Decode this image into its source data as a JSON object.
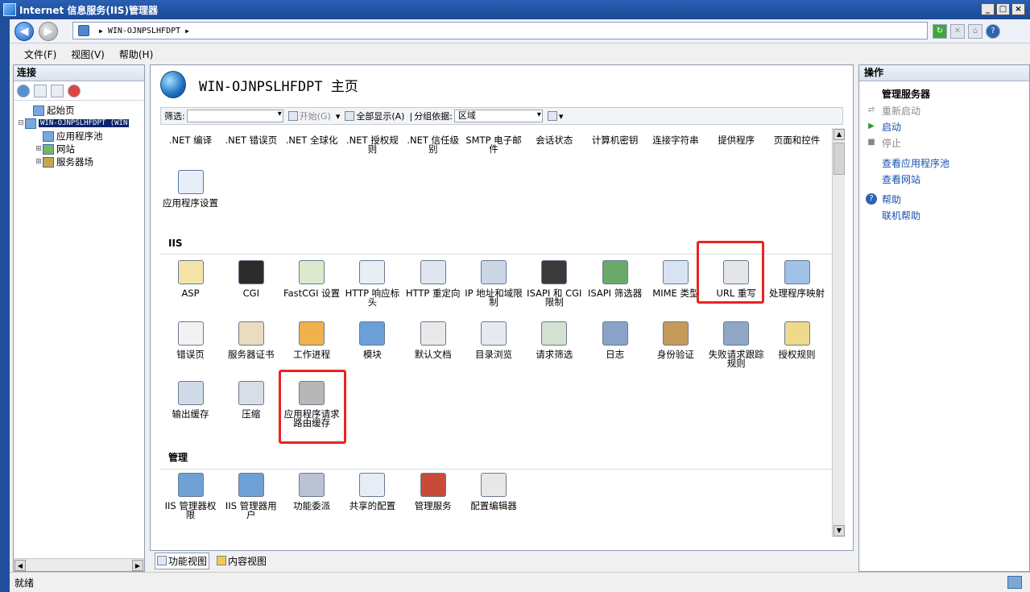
{
  "window": {
    "title": "Internet 信息服务(IIS)管理器",
    "controls": [
      "_",
      "□",
      "×"
    ]
  },
  "address": {
    "path": "WIN-OJNPSLHFDPT",
    "toolbar_icons": [
      "refresh-icon",
      "stop-icon",
      "home-icon",
      "help-icon"
    ]
  },
  "menu": [
    "文件(F)",
    "视图(V)",
    "帮助(H)"
  ],
  "connections": {
    "title": "连接",
    "tree": [
      {
        "label": "起始页",
        "indent": 1,
        "glyph": ""
      },
      {
        "label": "WIN-OJNPSLHFDPT (WIN",
        "indent": 0,
        "glyph": "⊟",
        "selected": true
      },
      {
        "label": "应用程序池",
        "indent": 2,
        "glyph": ""
      },
      {
        "label": "网站",
        "indent": 1,
        "glyph": "⊞"
      },
      {
        "label": "服务器场",
        "indent": 1,
        "glyph": "⊞"
      }
    ]
  },
  "main": {
    "title": "WIN-OJNPSLHFDPT 主页",
    "filter": {
      "label": "筛选:",
      "go": "开始(G)",
      "show_all": "全部显示(A)",
      "group_label": "分组依据:",
      "group_value": "区域"
    },
    "aspnet_row": [
      ".NET 编译",
      ".NET 错误页",
      ".NET 全球化",
      ".NET 授权规则",
      ".NET 信任级别",
      "SMTP 电子邮件",
      "会话状态",
      "计算机密钥",
      "连接字符串",
      "提供程序",
      "页面和控件"
    ],
    "aspnet_row2": [
      "应用程序设置"
    ],
    "sections": {
      "iis": "IIS",
      "manage": "管理"
    },
    "iis_row1": [
      "ASP",
      "CGI",
      "FastCGI 设置",
      "HTTP 响应标头",
      "HTTP 重定向",
      "IP 地址和域限制",
      "ISAPI 和 CGI 限制",
      "ISAPI 筛选器",
      "MIME 类型",
      "URL 重写",
      "处理程序映射"
    ],
    "iis_row2": [
      "错误页",
      "服务器证书",
      "工作进程",
      "模块",
      "默认文档",
      "目录浏览",
      "请求筛选",
      "日志",
      "身份验证",
      "失败请求跟踪规则",
      "授权规则"
    ],
    "iis_row3": [
      "输出缓存",
      "压缩",
      "应用程序请求路由缓存"
    ],
    "manage_row": [
      "IIS 管理器权限",
      "IIS 管理器用户",
      "功能委派",
      "共享的配置",
      "管理服务",
      "配置编辑器"
    ]
  },
  "views": {
    "features": "功能视图",
    "content": "内容视图"
  },
  "actions": {
    "title": "操作",
    "group": "管理服务器",
    "items": [
      {
        "label": "重新启动",
        "disabled": true,
        "icon": "restart-icon"
      },
      {
        "label": "启动",
        "disabled": false,
        "icon": "start-icon"
      },
      {
        "label": "停止",
        "disabled": true,
        "icon": "stop-icon"
      }
    ],
    "links": [
      "查看应用程序池",
      "查看网站"
    ],
    "help": [
      "帮助",
      "联机帮助"
    ]
  },
  "status": {
    "text": "就绪"
  },
  "colors": {
    "highlight": "#e8241f",
    "link": "#1a4fb0",
    "titlebar": "#1b4a97"
  }
}
